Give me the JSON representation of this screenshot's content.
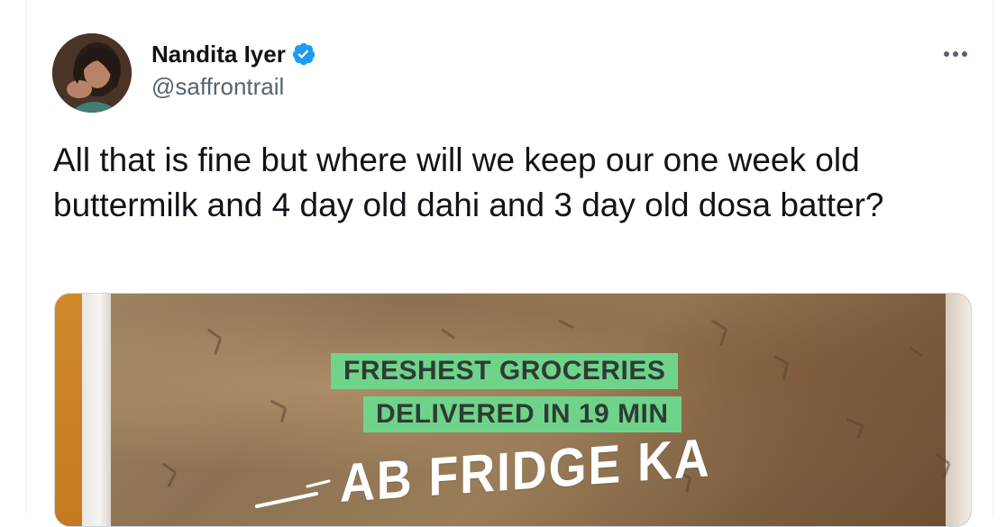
{
  "author": {
    "display_name": "Nandita Iyer",
    "handle": "@saffrontrail",
    "verified": true,
    "avatar_icon": "profile-photo"
  },
  "menu": {
    "more_icon": "more-dots-icon"
  },
  "tweet": {
    "text": "All that is fine but where will we keep our one week old buttermilk and 4 day old dahi and 3 day old dosa batter?"
  },
  "media": {
    "banner_line_1": "FRESHEST GROCERIES",
    "banner_line_2": "DELIVERED IN 19 MIN",
    "slogan": "AB FRIDGE KA"
  },
  "colors": {
    "verified_blue": "#1d9bf0",
    "banner_green": "#6fd48a",
    "text_primary": "#0f1419",
    "text_secondary": "#536471"
  }
}
